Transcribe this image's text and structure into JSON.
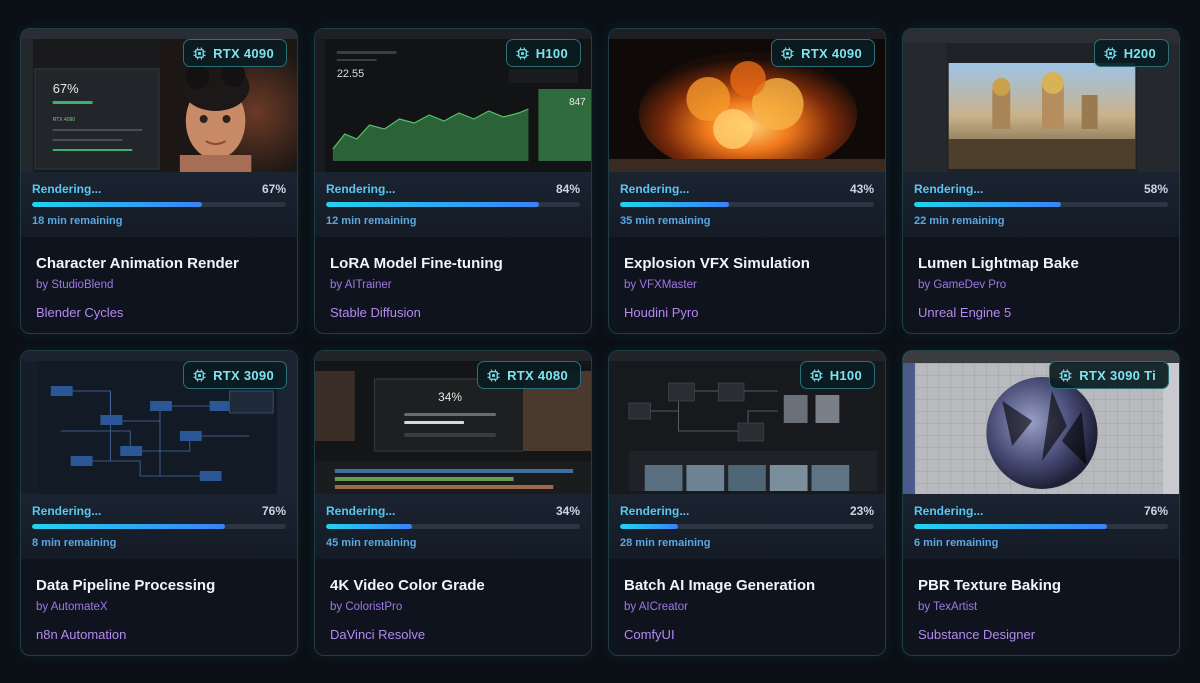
{
  "jobs": [
    {
      "gpu": "RTX 4090",
      "status": "Rendering...",
      "percent_label": "67%",
      "progress": 0.67,
      "remaining": "18 min remaining",
      "title": "Character Animation Render",
      "author": "by StudioBlend",
      "software": "Blender Cycles",
      "preview_texts": [
        "67%",
        "RTX 4090"
      ]
    },
    {
      "gpu": "H100",
      "status": "Rendering...",
      "percent_label": "84%",
      "progress": 0.84,
      "remaining": "12 min remaining",
      "title": "LoRA Model Fine-tuning",
      "author": "by AITrainer",
      "software": "Stable Diffusion",
      "preview_texts": [
        "22.55",
        "847"
      ]
    },
    {
      "gpu": "RTX 4090",
      "status": "Rendering...",
      "percent_label": "43%",
      "progress": 0.43,
      "remaining": "35 min remaining",
      "title": "Explosion VFX Simulation",
      "author": "by VFXMaster",
      "software": "Houdini Pyro",
      "preview_texts": []
    },
    {
      "gpu": "H200",
      "status": "Rendering...",
      "percent_label": "58%",
      "progress": 0.58,
      "remaining": "22 min remaining",
      "title": "Lumen Lightmap Bake",
      "author": "by GameDev Pro",
      "software": "Unreal Engine 5",
      "preview_texts": []
    },
    {
      "gpu": "RTX 3090",
      "status": "Rendering...",
      "percent_label": "76%",
      "progress": 0.76,
      "remaining": "8 min remaining",
      "title": "Data Pipeline Processing",
      "author": "by AutomateX",
      "software": "n8n Automation",
      "preview_texts": []
    },
    {
      "gpu": "RTX 4080",
      "status": "Rendering...",
      "percent_label": "34%",
      "progress": 0.34,
      "remaining": "45 min remaining",
      "title": "4K Video Color Grade",
      "author": "by ColoristPro",
      "software": "DaVinci Resolve",
      "preview_texts": [
        "34%"
      ]
    },
    {
      "gpu": "H100",
      "status": "Rendering...",
      "percent_label": "23%",
      "progress": 0.23,
      "remaining": "28 min remaining",
      "title": "Batch AI Image Generation",
      "author": "by AICreator",
      "software": "ComfyUI",
      "preview_texts": []
    },
    {
      "gpu": "RTX 3090 Ti",
      "status": "Rendering...",
      "percent_label": "76%",
      "progress": 0.76,
      "remaining": "6 min remaining",
      "title": "PBR Texture Baking",
      "author": "by TexArtist",
      "software": "Substance Designer",
      "preview_texts": []
    }
  ],
  "colors": {
    "background": "#0b1016",
    "card_border": "#1f3d45",
    "accent_cyan": "#5cc6f0",
    "progress_start": "#22d3ee",
    "progress_end": "#3b82f6",
    "author_purple": "#a078e6",
    "badge_text": "#7fe3ee"
  },
  "icons": {
    "gpu_badge": "cpu-chip-icon"
  }
}
